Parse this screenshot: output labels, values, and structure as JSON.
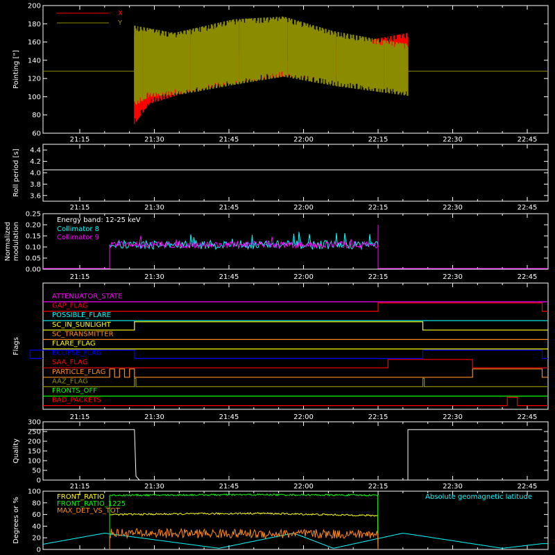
{
  "colors": {
    "axis": "#ffffff",
    "red": "#ff0000",
    "olive": "#8b8b00",
    "cyan": "#00ffff",
    "magenta": "#ff00ff",
    "green": "#00ff00",
    "yellow": "#ffff00",
    "orange": "#ff8c1a",
    "blue": "#0000ff",
    "orangered": "#ff3300"
  },
  "time_ticks": [
    "21:15",
    "21:30",
    "21:45",
    "22:00",
    "22:15",
    "22:30",
    "22:45"
  ],
  "chart_data": [
    {
      "type": "line",
      "id": "pointing",
      "ylabel": "Pointing [\"]",
      "ylim": [
        60,
        200
      ],
      "yticks": [
        "60",
        "80",
        "100",
        "120",
        "140",
        "160",
        "180",
        "200"
      ],
      "xrange_hours": [
        "21:05",
        "22:48"
      ],
      "series": [
        {
          "name": "X",
          "color": "red",
          "start": "21:26",
          "end": "22:21",
          "upper": [
            [
              0,
              168
            ],
            [
              8,
              162
            ],
            [
              20,
              150
            ],
            [
              32,
              142
            ],
            [
              40,
              155
            ],
            [
              50,
              165
            ],
            [
              55,
              170
            ]
          ],
          "lower": [
            [
              0,
              70
            ],
            [
              3,
              92
            ],
            [
              10,
              104
            ],
            [
              20,
              115
            ],
            [
              30,
              122
            ],
            [
              40,
              119
            ],
            [
              55,
              115
            ]
          ]
        },
        {
          "name": "Y",
          "color": "olive",
          "start": "21:26",
          "end": "22:21",
          "upper": [
            [
              0,
              178
            ],
            [
              8,
              170
            ],
            [
              20,
              185
            ],
            [
              30,
              188
            ],
            [
              40,
              172
            ],
            [
              50,
              162
            ],
            [
              55,
              158
            ]
          ],
          "lower": [
            [
              0,
              90
            ],
            [
              3,
              100
            ],
            [
              10,
              103
            ],
            [
              20,
              113
            ],
            [
              30,
              122
            ],
            [
              40,
              112
            ],
            [
              55,
              101
            ]
          ]
        }
      ],
      "hline": 128,
      "legend": "top-left"
    },
    {
      "type": "line",
      "id": "roll",
      "ylabel": "Roll period [s]",
      "ylim": [
        3.5,
        4.5
      ],
      "yticks": [
        "3.6",
        "3.8",
        "4.0",
        "4.2",
        "4.4"
      ],
      "value": 4.05
    },
    {
      "type": "line",
      "id": "modulation",
      "ylabel_lines": [
        "Normalized",
        "modulation"
      ],
      "ylim": [
        0,
        0.25
      ],
      "yticks": [
        "0.00",
        "0.05",
        "0.10",
        "0.15",
        "0.20",
        "0.25"
      ],
      "annotation": "Energy band: 12-25 keV",
      "series": [
        {
          "name": "Collimator 8",
          "color": "cyan",
          "start": "21:21",
          "end": "22:15",
          "mean": 0.11,
          "spread": 0.02
        },
        {
          "name": "Collimator 9",
          "color": "magenta",
          "start": "21:21",
          "end": "22:15",
          "mean": 0.11,
          "spread": 0.015
        }
      ]
    },
    {
      "type": "line",
      "id": "flags",
      "ylabel": "Flags",
      "flags": [
        {
          "name": "ATTENUATOR_STATE",
          "color": "magenta",
          "steps": []
        },
        {
          "name": "GAP_FLAG",
          "color": "red",
          "steps": [
            [
              "22:15",
              "22:48"
            ]
          ]
        },
        {
          "name": "POSSIBLE_FLARE",
          "color": "cyan",
          "steps": []
        },
        {
          "name": "SC_IN_SUNLIGHT",
          "color": "yellow",
          "steps": [
            [
              "21:26",
              "22:24"
            ]
          ]
        },
        {
          "name": "SC_TRANSMITTER",
          "color": "orange",
          "steps": []
        },
        {
          "name": "FLARE_FLAG",
          "color": "yellow",
          "steps": []
        },
        {
          "name": "ECLIPSE_FLAG",
          "color": "blue",
          "steps": [
            [
              "21:05",
              "21:26"
            ],
            [
              "22:24",
              "22:48"
            ]
          ]
        },
        {
          "name": "SAA_FLAG",
          "color": "red",
          "steps": [
            [
              "22:17",
              "22:34"
            ]
          ]
        },
        {
          "name": "PARTICLE_FLAG",
          "color": "orange",
          "steps": [
            [
              "21:21",
              "21:22"
            ],
            [
              "21:23",
              "21:24"
            ],
            [
              "21:25",
              "21:26"
            ],
            [
              "22:34",
              "22:48"
            ]
          ]
        },
        {
          "name": "AAZ_FLAG",
          "color": "olive",
          "steps": [
            [
              "21:26",
              "21:26.3"
            ],
            [
              "22:24",
              "22:24.3"
            ]
          ]
        },
        {
          "name": "FRONTS_OFF",
          "color": "green",
          "steps": []
        },
        {
          "name": "BAD_PACKETS",
          "color": "red",
          "steps": [
            [
              "22:41",
              "22:43"
            ]
          ]
        }
      ]
    },
    {
      "type": "line",
      "id": "quality",
      "ylabel": "Quality",
      "ylim": [
        0,
        300
      ],
      "yticks": [
        "0",
        "50",
        "100",
        "150",
        "200",
        "250",
        "300"
      ],
      "series": [
        {
          "name": "",
          "color": "axis",
          "points": [
            [
              "21:05",
              260
            ],
            [
              "21:26",
              260
            ],
            [
              "21:26.3",
              20
            ],
            [
              "21:27",
              0
            ],
            [
              "22:21",
              0
            ],
            [
              "22:21",
              260
            ],
            [
              "22:48",
              260
            ]
          ]
        }
      ]
    },
    {
      "type": "line",
      "id": "front",
      "ylabel": "Degrees or %",
      "ylim": [
        0,
        100
      ],
      "yticks": [
        "0",
        "20",
        "40",
        "60",
        "80",
        "100"
      ],
      "annotation": "Absolute geomagnetic latitude",
      "series": [
        {
          "name": "FRONT_RATIO",
          "color": "yellow",
          "start": "21:21",
          "end": "22:15",
          "values": [
            [
              0,
              60
            ],
            [
              30,
              62
            ],
            [
              54,
              58
            ]
          ]
        },
        {
          "name": "FRONT_RATIO_1225",
          "color": "green",
          "start": "21:21",
          "end": "22:15",
          "values": [
            [
              0,
              93
            ],
            [
              30,
              94
            ],
            [
              54,
              93
            ]
          ]
        },
        {
          "name": "MAX_DET_VS_TOT",
          "color": "orange",
          "start": "21:21",
          "end": "22:15",
          "values": [
            [
              0,
              28
            ],
            [
              30,
              27
            ],
            [
              54,
              26
            ]
          ]
        }
      ],
      "latitude": [
        [
          "21:05",
          5
        ],
        [
          "21:20",
          28
        ],
        [
          "21:43",
          2
        ],
        [
          "21:58",
          28
        ],
        [
          "22:06",
          2
        ],
        [
          "22:20",
          28
        ],
        [
          "22:40",
          2
        ],
        [
          "22:48",
          10
        ]
      ]
    }
  ]
}
